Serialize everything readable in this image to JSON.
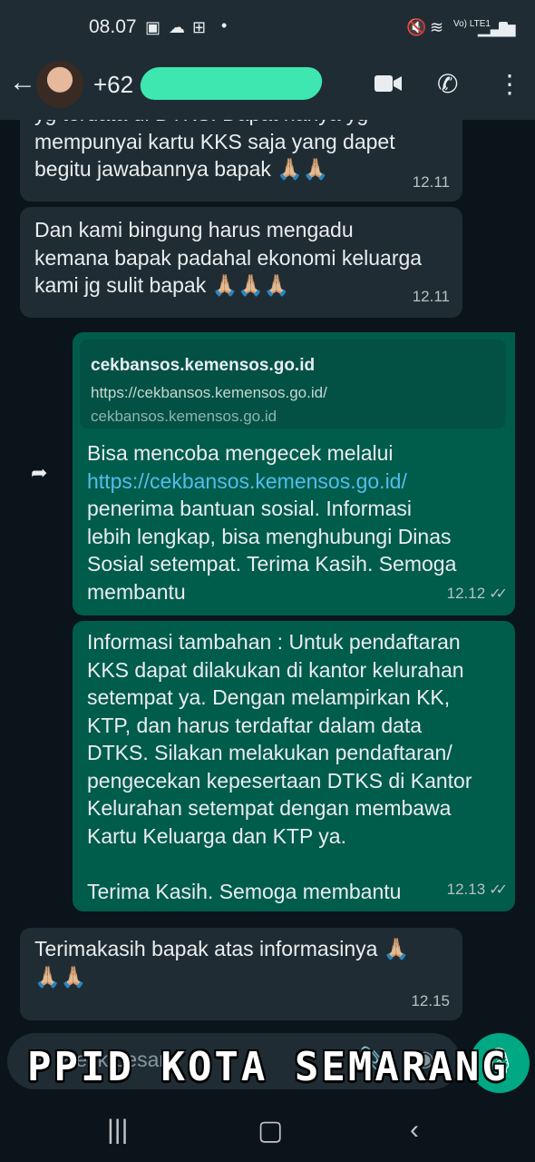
{
  "status_bar": {
    "time": "08.07",
    "left_icons": [
      "image-icon",
      "cloud-icon",
      "gift-icon",
      "dot-icon"
    ],
    "network_label": "Vo) LTE1"
  },
  "header": {
    "contact_name": "+62",
    "icons": [
      "back-icon",
      "video-call-icon",
      "voice-call-icon",
      "more-icon"
    ]
  },
  "messages": [
    {
      "direction": "incoming",
      "text": "yg terdata di DTKS. Dapat hanya yg\nmempunyai kartu KKS saja yang dapet\nbegitu jawabannya bapak 🙏🏼🙏🏼",
      "time": "12.11"
    },
    {
      "direction": "incoming",
      "text": "Dan kami bingung harus mengadu\nkemana bapak padahal ekonomi keluarga\nkami jg sulit bapak 🙏🏼🙏🏼🙏🏼",
      "time": "12.11"
    },
    {
      "direction": "outgoing",
      "link_preview": {
        "title": "cekbansos.kemensos.go.id",
        "url": "https://cekbansos.kemensos.go.id/",
        "domain": "cekbansos.kemensos.go.id"
      },
      "text_before_link": "Bisa mencoba mengecek melalui",
      "link": "https://cekbansos.kemensos.go.id/",
      "text_after_link": "penerima bantuan sosial. Informasi\nlebih lengkap, bisa menghubungi Dinas\nSosial setempat. Terima Kasih. Semoga\nmembantu",
      "time": "12.12",
      "ticks": "✓✓"
    },
    {
      "direction": "outgoing",
      "text": "Informasi tambahan : Untuk pendaftaran\nKKS dapat dilakukan di kantor kelurahan\nsetempat ya. Dengan melampirkan KK,\nKTP, dan harus terdaftar dalam data\nDTKS. Silakan melakukan pendaftaran/\npengecekan kepesertaan DTKS di Kantor\nKelurahan setempat dengan membawa\nKartu Keluarga dan KTP ya.\n\nTerima Kasih. Semoga membantu",
      "time": "12.13",
      "ticks": "✓✓"
    },
    {
      "direction": "incoming",
      "text": "Terimakasih bapak atas informasinya 🙏🏼\n🙏🏼🙏🏼",
      "time": "12.15"
    }
  ],
  "input": {
    "placeholder": "Ketik pesan"
  },
  "watermark": "PPID KOTA SEMARANG",
  "colors": {
    "chat_background": "#0b141a",
    "incoming_bubble": "#202c33",
    "outgoing_bubble": "#005c4b",
    "accent": "#00a884",
    "link": "#53bdeb"
  }
}
